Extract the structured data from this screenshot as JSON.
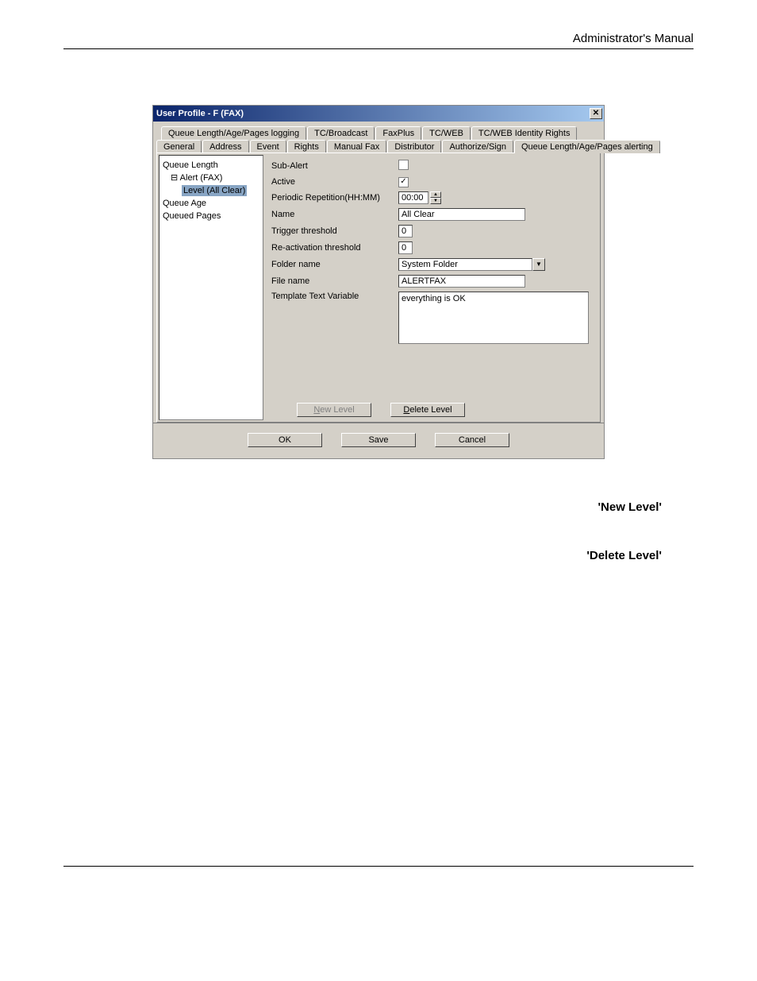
{
  "header": {
    "title": "Administrator's Manual"
  },
  "dialog": {
    "title": "User Profile - F (FAX)",
    "closeGlyph": "✕",
    "tabsRow1": [
      "Queue Length/Age/Pages logging",
      "TC/Broadcast",
      "FaxPlus",
      "TC/WEB",
      "TC/WEB Identity Rights"
    ],
    "tabsRow2": [
      "General",
      "Address",
      "Event",
      "Rights",
      "Manual Fax",
      "Distributor",
      "Authorize/Sign",
      "Queue Length/Age/Pages alerting"
    ],
    "tree": {
      "n0": "Queue Length",
      "n1": "Alert (FAX)",
      "n1_expand": "⊟",
      "n2": "Level (All Clear)",
      "n3": "Queue Age",
      "n4": "Queued Pages"
    },
    "form": {
      "subalert_label": "Sub-Alert",
      "active_label": "Active",
      "active_checked": "✓",
      "periodic_label": "Periodic Repetition(HH:MM)",
      "periodic_value": "00:00",
      "spin_up": "▲",
      "spin_down": "▼",
      "name_label": "Name",
      "name_value": "All Clear",
      "trigger_label": "Trigger threshold",
      "trigger_value": "0",
      "react_label": "Re-activation threshold",
      "react_value": "0",
      "folder_label": "Folder name",
      "folder_value": "System Folder",
      "dd_arrow": "▼",
      "file_label": "File name",
      "file_value": "ALERTFAX",
      "tmpl_label": "Template Text Variable",
      "tmpl_value": "everything is OK"
    },
    "levelButtons": {
      "new_pre": "",
      "new_acc": "N",
      "new_post": "ew Level",
      "del_pre": "",
      "del_acc": "D",
      "del_post": "elete Level"
    },
    "bottom": {
      "ok": "OK",
      "save": "Save",
      "cancel": "Cancel"
    }
  },
  "doc": {
    "para1_bold": "'New Level'",
    "para2_bold": "'Delete Level'"
  }
}
